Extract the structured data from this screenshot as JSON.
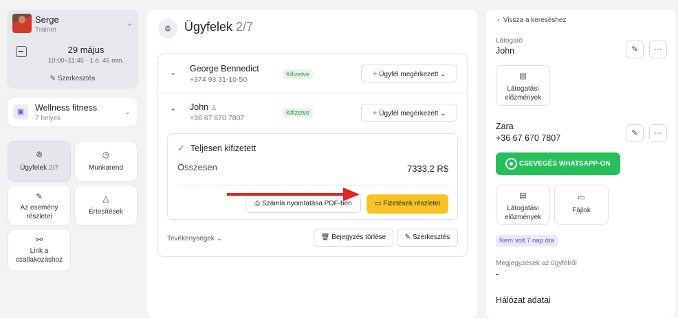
{
  "profile": {
    "name": "Serge",
    "role": "Trainer",
    "date": "29 május",
    "time": "10:00–11:45 · 1 ó. 45 min.",
    "edit_label": "Szerkesztés"
  },
  "venue": {
    "name": "Wellness fitness",
    "sub": "7 helyek"
  },
  "nav_tiles": [
    {
      "label": "Ügyfelek",
      "count": "2/7"
    },
    {
      "label": "Munkarend"
    },
    {
      "label": "Az esemény részletei"
    },
    {
      "label": "Értesítések"
    },
    {
      "label": "Link a csatlakozáshoz"
    }
  ],
  "customers": {
    "title": "Ügyfelek",
    "count": "2/7",
    "rows": [
      {
        "name": "George Bennedict",
        "phone": "+374 93 31-10-50",
        "badge": "Kifizetve",
        "action": "Ügyfél megérkezett"
      },
      {
        "name": "John",
        "phone": "+36 67 670 7807",
        "badge": "Kifizetve",
        "action": "Ügyfél megérkezett"
      }
    ],
    "payment": {
      "status": "Teljesen kifizetett",
      "total_label": "Összesen",
      "total_value": "7333,2 R$",
      "print_label": "Számla nyomtatása PDF-ben",
      "details_label": "Fizetések részletei"
    },
    "activities_label": "Tevékenységek",
    "delete_label": "Bejegyzés törlése",
    "edit_label": "Szerkesztés"
  },
  "right": {
    "back_label": "Vissza a kereséshez",
    "visitor_label": "Látogató",
    "visitor_name": "John",
    "history_label": "Látogatási előzmények",
    "client_name": "Zara",
    "client_phone": "+36 67 670 7807",
    "whatsapp_label": "CSEVEGÉS WHATSAPP-ON",
    "history2_label": "Látogatási előzmények",
    "files_label": "Fájlok",
    "tag": "Nem volt 7 nap óta",
    "notes_label": "Megjegyzések az ügyfélről",
    "notes_value": "-",
    "network_title": "Hálózat adatai"
  },
  "colors": {
    "accent_yellow": "#f7c325",
    "whatsapp_green": "#25c05a",
    "annotation_arrow": "#e02727"
  }
}
